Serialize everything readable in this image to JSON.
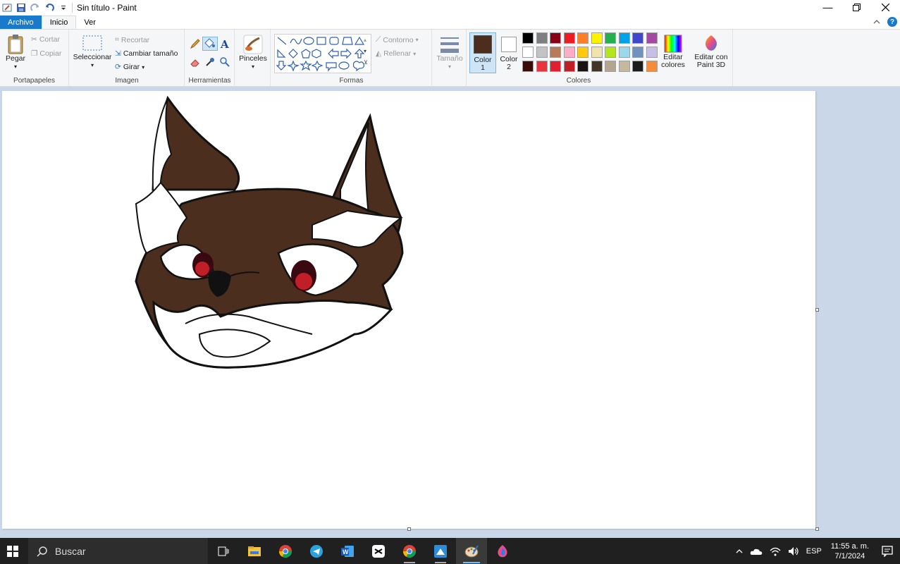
{
  "window": {
    "title": "Sin título - Paint",
    "minimize_icon": "minimize-icon",
    "maximize_icon": "restore-icon",
    "close_icon": "close-icon"
  },
  "quick_access": {
    "icons": [
      "paint-app-icon",
      "save-icon",
      "redo-icon",
      "undo-icon",
      "customize-qat-icon"
    ]
  },
  "tabs": {
    "file": "Archivo",
    "home": "Inicio",
    "view": "Ver"
  },
  "ribbon": {
    "clipboard": {
      "label": "Portapapeles",
      "paste": "Pegar",
      "cut": "Cortar",
      "copy": "Copiar"
    },
    "image": {
      "label": "Imagen",
      "select": "Seleccionar",
      "crop": "Recortar",
      "resize": "Cambiar tamaño",
      "rotate": "Girar"
    },
    "tools": {
      "label": "Herramientas"
    },
    "brushes": {
      "label": "Pinceles"
    },
    "shapes": {
      "label": "Formas",
      "outline": "Contorno",
      "fill": "Rellenar"
    },
    "size": {
      "label": "Tamaño"
    },
    "colors": {
      "label": "Colores",
      "color1": "Color",
      "color1_num": "1",
      "color2": "Color",
      "color2_num": "2",
      "color1_value": "#4b2e1e",
      "color2_value": "#ffffff",
      "edit_colors_1": "Editar",
      "edit_colors_2": "colores",
      "paint3d_1": "Editar con",
      "paint3d_2": "Paint 3D",
      "palette": [
        [
          "#000000",
          "#7f7f7f",
          "#880015",
          "#ed1c24",
          "#ff7f27",
          "#fff200",
          "#22b14c",
          "#00a2e8",
          "#3f48cc",
          "#a349a4"
        ],
        [
          "#ffffff",
          "#c3c3c3",
          "#b97a57",
          "#ffaec9",
          "#ffc90e",
          "#efe4b0",
          "#b5e61d",
          "#99d9ea",
          "#7092be",
          "#c8bfe7"
        ],
        [
          "#3d0a0a",
          "#e8343f",
          "#e02030",
          "#c11f27",
          "#1a1410",
          "#413525",
          "#b3a58f",
          "#c4b89f",
          "#1b1b1b",
          "#f48c3a"
        ]
      ]
    }
  },
  "taskbar": {
    "search_placeholder": "Buscar",
    "lang": "ESP",
    "time": "11:55 a. m.",
    "date": "7/1/2024"
  }
}
